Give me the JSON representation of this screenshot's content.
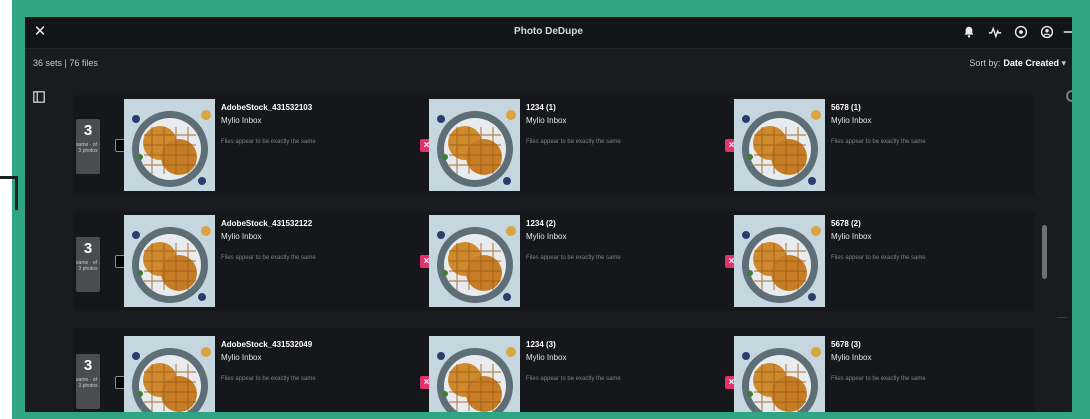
{
  "app": {
    "title": "Photo DeDupe",
    "close_glyph": "✕"
  },
  "toolbar": {
    "icons": [
      "bell-icon",
      "activity-icon",
      "help-icon",
      "account-icon",
      "more-icon"
    ],
    "sort_label": "Sort by:",
    "sort_value": "Date Created",
    "sort_arrow": "▾"
  },
  "summary": {
    "counts": "36 sets  |  76 files"
  },
  "colors": {
    "frame": "#2fa585",
    "remove": "#e4336c",
    "background": "#1a1b20"
  },
  "sets": [
    {
      "count": "3",
      "count_label": "same · of · 3 photos",
      "files": [
        {
          "name": "AdobeStock_431532103",
          "location": "Mylio Inbox",
          "note": "Files appear to be exactly the same",
          "action": "keep"
        },
        {
          "name": "1234 (1)",
          "location": "Mylio Inbox",
          "note": "Files appear to be exactly the same",
          "action": "remove"
        },
        {
          "name": "5678 (1)",
          "location": "Mylio Inbox",
          "note": "Files appear to be exactly the same",
          "action": "remove"
        }
      ]
    },
    {
      "count": "3",
      "count_label": "same · of · 3 photos",
      "files": [
        {
          "name": "AdobeStock_431532122",
          "location": "Mylio Inbox",
          "note": "Files appear to be exactly the same",
          "action": "keep"
        },
        {
          "name": "1234 (2)",
          "location": "Mylio Inbox",
          "note": "Files appear to be exactly the same",
          "action": "remove"
        },
        {
          "name": "5678 (2)",
          "location": "Mylio Inbox",
          "note": "Files appear to be exactly the same",
          "action": "remove"
        }
      ]
    },
    {
      "count": "3",
      "count_label": "same · of · 3 photos",
      "files": [
        {
          "name": "AdobeStock_431532049",
          "location": "Mylio Inbox",
          "note": "Files appear to be exactly the same",
          "action": "keep"
        },
        {
          "name": "1234 (3)",
          "location": "Mylio Inbox",
          "note": "Files appear to be exactly the same",
          "action": "remove"
        },
        {
          "name": "5678 (3)",
          "location": "Mylio Inbox",
          "note": "Files appear to be exactly the same",
          "action": "remove"
        }
      ]
    }
  ]
}
